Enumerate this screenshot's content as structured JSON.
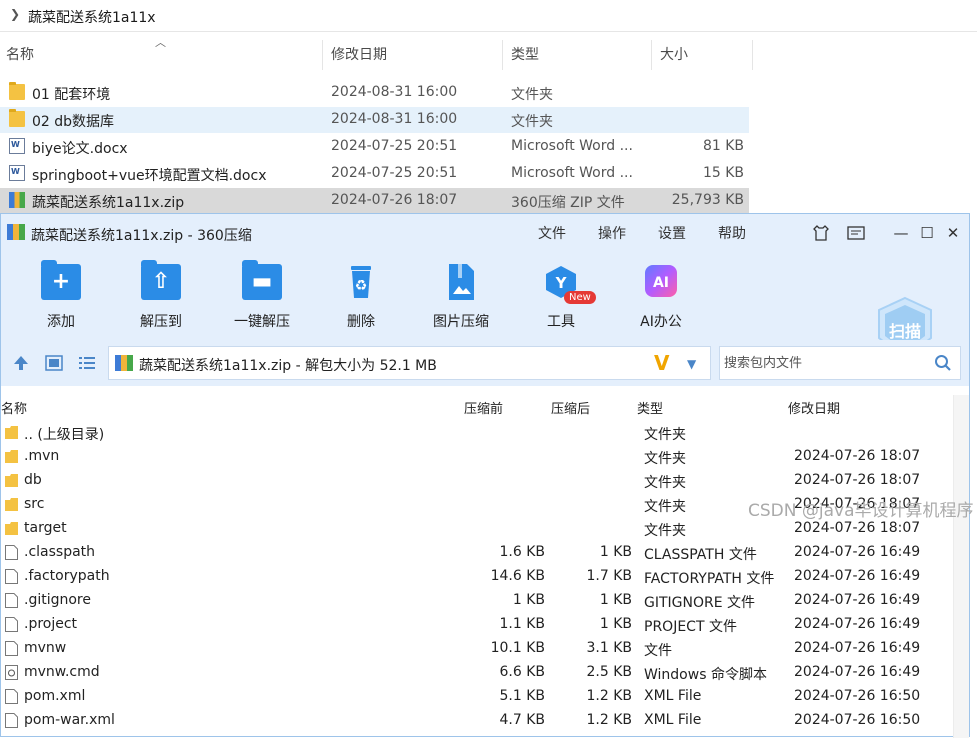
{
  "explorer": {
    "breadcrumb": "蔬菜配送系统1a11x",
    "columns": [
      "名称",
      "修改日期",
      "类型",
      "大小"
    ],
    "rows": [
      {
        "name": "01 配套环境",
        "date": "2024-08-31 16:00",
        "type": "文件夹",
        "size": "",
        "icon": "folder-icon"
      },
      {
        "name": "02 db数据库",
        "date": "2024-08-31 16:00",
        "type": "文件夹",
        "size": "",
        "icon": "folder-icon"
      },
      {
        "name": "biye论文.docx",
        "date": "2024-07-25 20:51",
        "type": "Microsoft Word ...",
        "size": "81 KB",
        "icon": "word-doc-icon"
      },
      {
        "name": "springboot+vue环境配置文档.docx",
        "date": "2024-07-25 20:51",
        "type": "Microsoft Word ...",
        "size": "15 KB",
        "icon": "word-doc-icon"
      },
      {
        "name": "蔬菜配送系统1a11x.zip",
        "date": "2024-07-26 18:07",
        "type": "360压缩 ZIP 文件",
        "size": "25,793 KB",
        "icon": "zip-icon"
      }
    ]
  },
  "window": {
    "title": "蔬菜配送系统1a11x.zip - 360压缩",
    "menu": [
      "文件",
      "操作",
      "设置",
      "帮助"
    ],
    "toolbar": [
      "添加",
      "解压到",
      "一键解压",
      "删除",
      "图片压缩",
      "工具",
      "AI办公"
    ],
    "new_badge": "New",
    "scan_label": "扫描",
    "path": "蔬菜配送系统1a11x.zip - 解包大小为 52.1 MB",
    "search_placeholder": "搜索包内文件",
    "columns": [
      "名称",
      "压缩前",
      "压缩后",
      "类型",
      "修改日期"
    ],
    "files": [
      {
        "name": ".. (上级目录)",
        "before": "",
        "after": "",
        "type": "文件夹",
        "modified": "",
        "icon": "folder-icon"
      },
      {
        "name": ".mvn",
        "before": "",
        "after": "",
        "type": "文件夹",
        "modified": "2024-07-26 18:07",
        "icon": "folder-icon"
      },
      {
        "name": "db",
        "before": "",
        "after": "",
        "type": "文件夹",
        "modified": "2024-07-26 18:07",
        "icon": "folder-icon"
      },
      {
        "name": "src",
        "before": "",
        "after": "",
        "type": "文件夹",
        "modified": "2024-07-26 18:07",
        "icon": "folder-icon"
      },
      {
        "name": "target",
        "before": "",
        "after": "",
        "type": "文件夹",
        "modified": "2024-07-26 18:07",
        "icon": "folder-icon"
      },
      {
        "name": ".classpath",
        "before": "1.6 KB",
        "after": "1 KB",
        "type": "CLASSPATH 文件",
        "modified": "2024-07-26 16:49",
        "icon": "file-icon"
      },
      {
        "name": ".factorypath",
        "before": "14.6 KB",
        "after": "1.7 KB",
        "type": "FACTORYPATH 文件",
        "modified": "2024-07-26 16:49",
        "icon": "file-icon"
      },
      {
        "name": ".gitignore",
        "before": "1 KB",
        "after": "1 KB",
        "type": "GITIGNORE 文件",
        "modified": "2024-07-26 16:49",
        "icon": "file-icon"
      },
      {
        "name": ".project",
        "before": "1.1 KB",
        "after": "1 KB",
        "type": "PROJECT 文件",
        "modified": "2024-07-26 16:49",
        "icon": "file-icon"
      },
      {
        "name": "mvnw",
        "before": "10.1 KB",
        "after": "3.1 KB",
        "type": "文件",
        "modified": "2024-07-26 16:49",
        "icon": "file-icon"
      },
      {
        "name": "mvnw.cmd",
        "before": "6.6 KB",
        "after": "2.5 KB",
        "type": "Windows 命令脚本",
        "modified": "2024-07-26 16:49",
        "icon": "cmd-script-icon"
      },
      {
        "name": "pom.xml",
        "before": "5.1 KB",
        "after": "1.2 KB",
        "type": "XML File",
        "modified": "2024-07-26 16:50",
        "icon": "file-icon"
      },
      {
        "name": "pom-war.xml",
        "before": "4.7 KB",
        "after": "1.2 KB",
        "type": "XML File",
        "modified": "2024-07-26 16:50",
        "icon": "file-icon"
      }
    ]
  },
  "watermark": "CSDN @java毕设计算机程序"
}
